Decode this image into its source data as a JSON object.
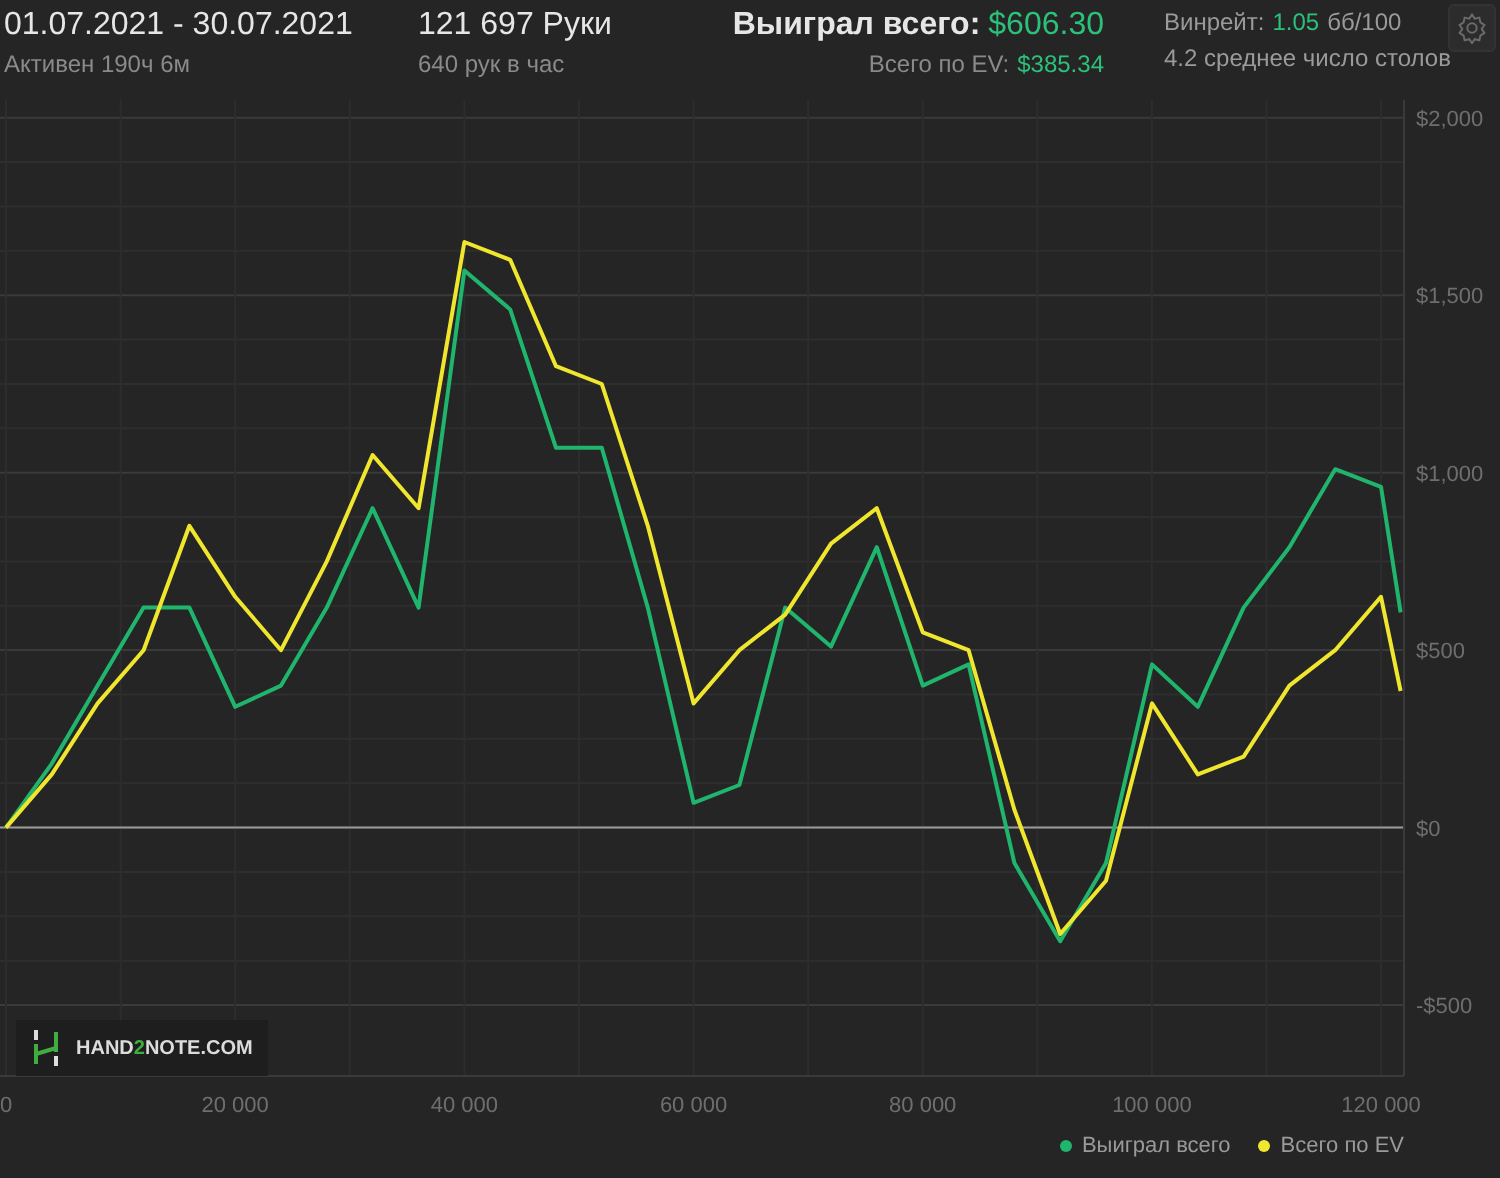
{
  "header": {
    "date_range": "01.07.2021 - 30.07.2021",
    "active_time": "Активен 190ч 6м",
    "hands": "121 697 Руки",
    "hands_per_hour": "640 рук в час",
    "won_label": "Выиграл всего:",
    "won_value": "$606.30",
    "ev_label": "Всего по EV:",
    "ev_value": "$385.34",
    "winrate_label": "Винрейт:",
    "winrate_value": "1.05",
    "winrate_unit": "бб/100",
    "avg_tables": "4.2 среднее число столов"
  },
  "logo": {
    "parts": [
      {
        "text": "HAND",
        "accent": false
      },
      {
        "text": "2",
        "accent": true
      },
      {
        "text": "NOTE.COM",
        "accent": false
      }
    ]
  },
  "chart": {
    "chart_data": {
      "type": "line",
      "x": [
        0,
        4000,
        8000,
        12000,
        16000,
        20000,
        24000,
        28000,
        32000,
        36000,
        40000,
        44000,
        48000,
        52000,
        56000,
        60000,
        64000,
        68000,
        72000,
        76000,
        80000,
        84000,
        88000,
        92000,
        96000,
        100000,
        104000,
        108000,
        112000,
        116000,
        120000,
        121697
      ],
      "series": [
        {
          "name": "Выиграл всего",
          "color": "#1fb56c",
          "values": [
            0,
            180,
            400,
            620,
            620,
            340,
            400,
            620,
            900,
            620,
            1570,
            1460,
            1070,
            1070,
            620,
            70,
            120,
            620,
            510,
            790,
            400,
            460,
            -100,
            -320,
            -100,
            460,
            340,
            620,
            790,
            1010,
            960,
            606
          ]
        },
        {
          "name": "Всего по EV",
          "color": "#f0e62e",
          "values": [
            0,
            150,
            350,
            500,
            850,
            650,
            500,
            750,
            1050,
            900,
            1650,
            1600,
            1300,
            1250,
            850,
            350,
            500,
            600,
            800,
            900,
            550,
            500,
            50,
            -300,
            -150,
            350,
            150,
            200,
            400,
            500,
            650,
            385
          ]
        }
      ],
      "grid": true,
      "xlim": [
        0,
        122000
      ],
      "ylim": [
        -700,
        2050
      ],
      "xticks": [
        {
          "value": 0,
          "label": "0"
        },
        {
          "value": 20000,
          "label": "20 000"
        },
        {
          "value": 40000,
          "label": "40 000"
        },
        {
          "value": 60000,
          "label": "60 000"
        },
        {
          "value": 80000,
          "label": "80 000"
        },
        {
          "value": 100000,
          "label": "100 000"
        },
        {
          "value": 120000,
          "label": "120 000"
        }
      ],
      "yticks": [
        {
          "value": -500,
          "label": "-$500"
        },
        {
          "value": 0,
          "label": "$0"
        },
        {
          "value": 500,
          "label": "$500"
        },
        {
          "value": 1000,
          "label": "$1,000"
        },
        {
          "value": 1500,
          "label": "$1,500"
        },
        {
          "value": 2000,
          "label": "$2,000"
        }
      ]
    }
  }
}
